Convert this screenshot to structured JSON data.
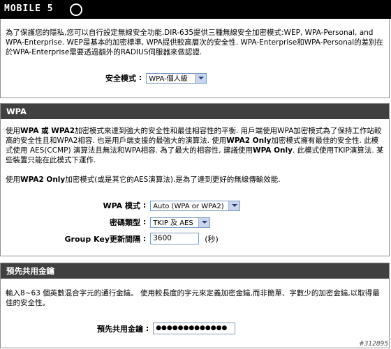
{
  "brand": {
    "logo_text": "MOBILE 5"
  },
  "security": {
    "intro": "為了保護您的隱私,您可以自行設定無線安全功能.DIR-635提供三種無線安全加密模式:WEP, WPA-Personal, and WPA-Enterprise. WEP是基本的加密標準, WPA提供較高層次的安全性. WPA-Enterprise和WPA-Personal的差別在於WPA-Enterprise需要透過額外的RADIUS伺服器來做認證.",
    "mode_label": "安全模式",
    "mode_value": "WPA-個人級"
  },
  "wpa": {
    "title": "WPA",
    "para1_a": "使用",
    "para1_b": "WPA 或 WPA2",
    "para1_c": "加密模式來達到強大的安全性和最佳相容性的平衡. 用戶端使用WPA加密模式為了保持工作站較高的安全性且和WPA2相容. 也是用戶端支援的最強大的演算法. 使用",
    "para1_d": "WPA2 Only",
    "para1_e": "加密模式擁有最佳的安全性. 此模式使用 AES(CCMP) 演算法且無法和WPA相容. 為了最大的相容性, 建議使用",
    "para1_f": "WPA Only",
    "para1_g": ". 此模式使用TKIP演算法. 某些裝置只能在此模式下運作.",
    "para2_a": "使用",
    "para2_b": "WPA2 Only",
    "para2_c": "加密模式(或是其它的AES演算法).是為了達到更好的無線傳輸效能.",
    "wpa_mode_label": "WPA 模式",
    "wpa_mode_value": "Auto (WPA or WPA2)",
    "cipher_label": "密碼類型",
    "cipher_value": "TKIP 及 AES",
    "group_key_label": "Group Key更新間隔",
    "group_key_value": "3600",
    "group_key_unit": "(秒)"
  },
  "psk": {
    "title": "預先共用金鑰",
    "intro": "輸入8~63 個英數混合字元的通行金鑰。 使用較長度的字元來定義加密金鑰,而非簡單、字數少的加密金鑰,以取得最佳的安全性。",
    "key_label": "預先共用金鑰",
    "key_value": "●●●●●●●●●●●●●"
  },
  "watermark": "#312895"
}
